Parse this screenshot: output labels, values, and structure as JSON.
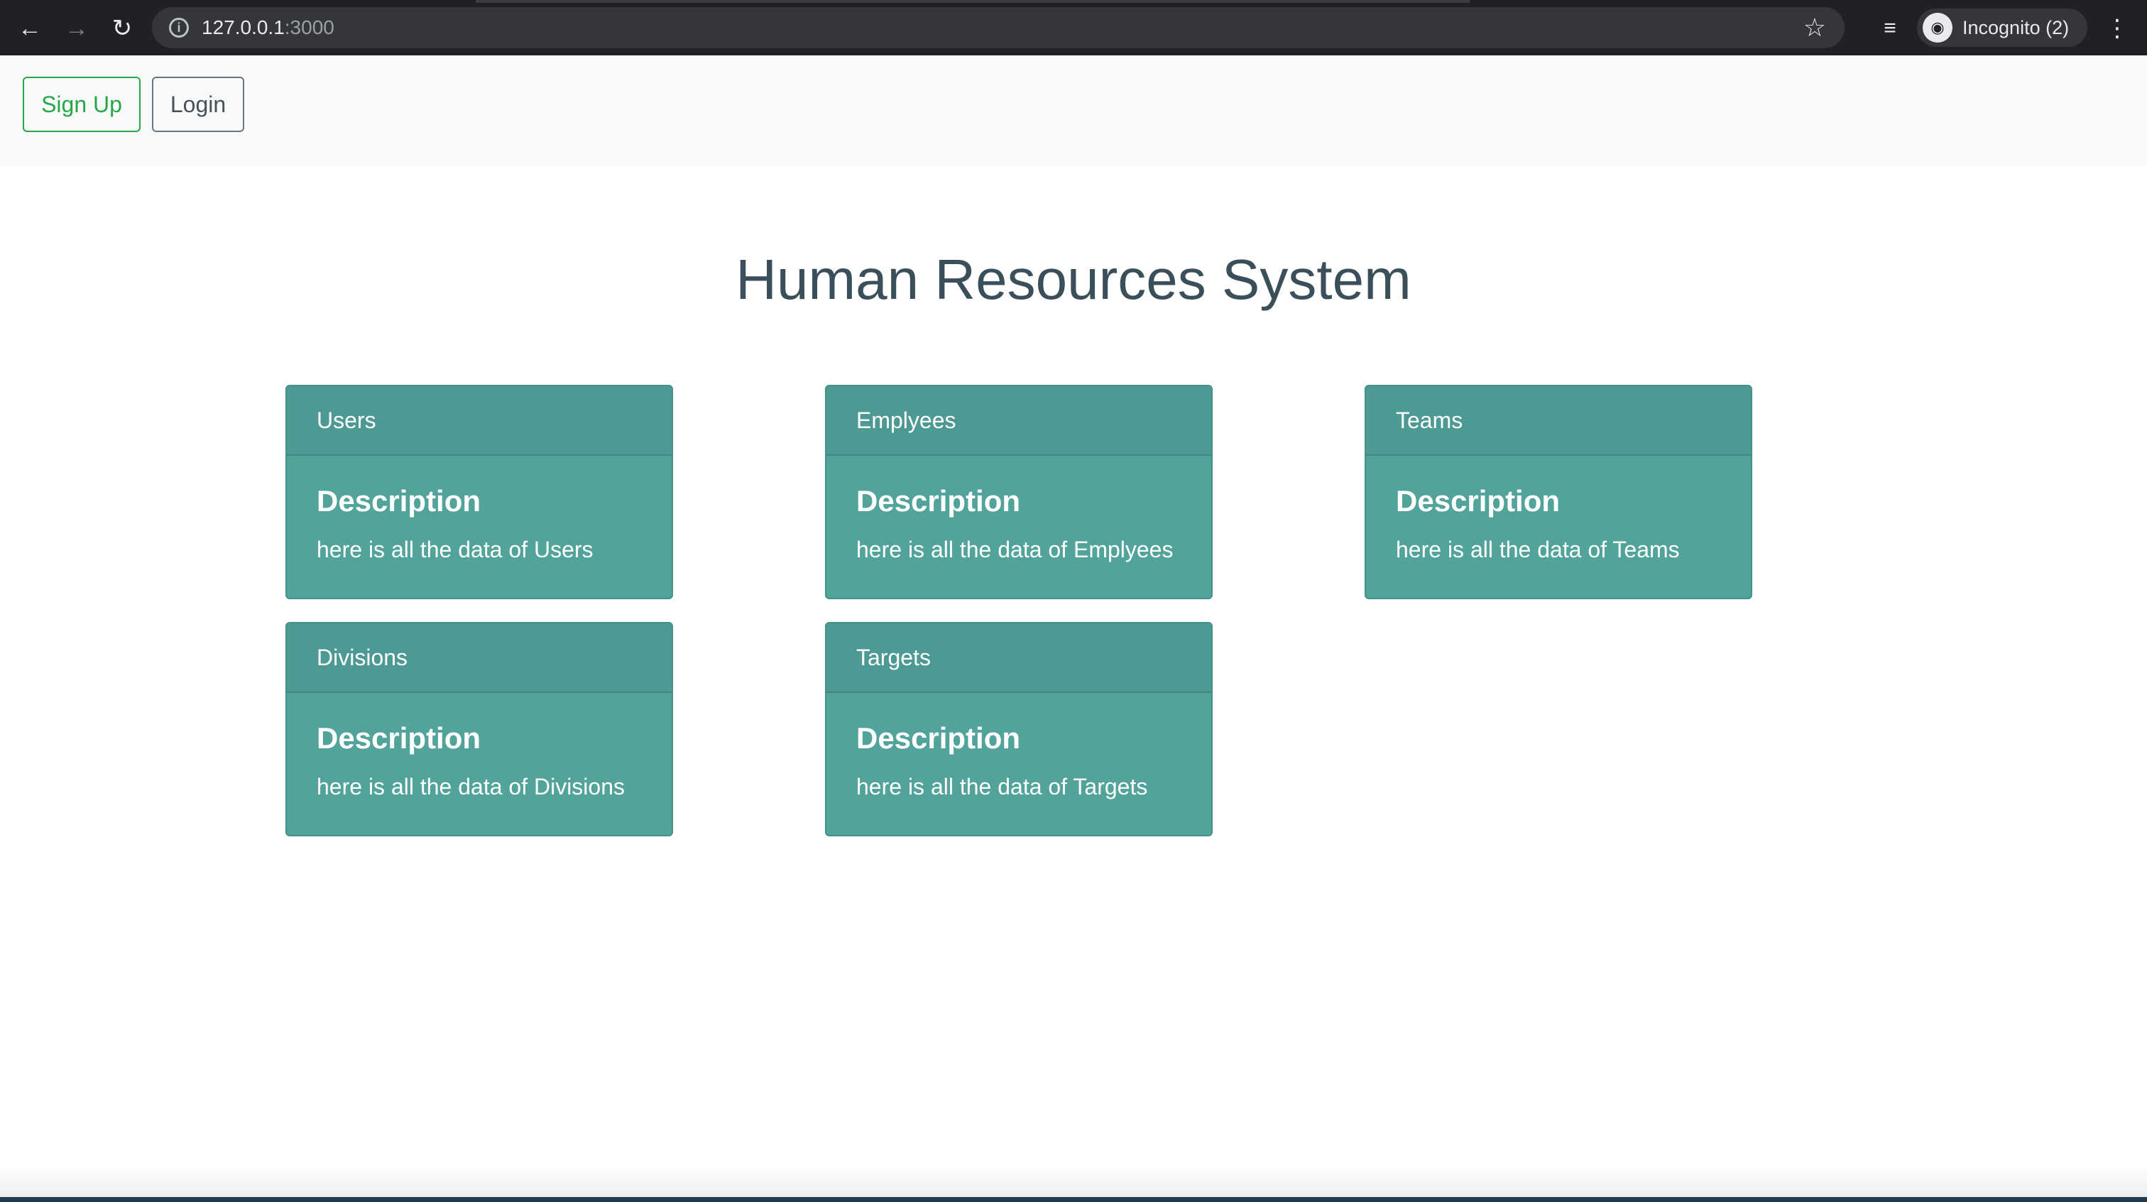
{
  "browser": {
    "url_host": "127.0.0.1",
    "url_port": ":3000",
    "profile_label": "Incognito (2)",
    "icons": {
      "back": "back-arrow-icon",
      "forward": "forward-arrow-icon",
      "reload": "reload-icon",
      "info": "info-icon",
      "bookmark": "star-icon",
      "tab_search": "tab-search-icon",
      "incognito": "incognito-icon",
      "menu": "kebab-menu-icon"
    }
  },
  "navbar": {
    "signup_label": "Sign Up",
    "login_label": "Login"
  },
  "main": {
    "title": "Human Resources System",
    "cards": [
      {
        "header": "Users",
        "title": "Description",
        "text": "here is all the data of Users"
      },
      {
        "header": "Emplyees",
        "title": "Description",
        "text": "here is all the data of Emplyees"
      },
      {
        "header": "Teams",
        "title": "Description",
        "text": "here is all the data of Teams"
      },
      {
        "header": "Divisions",
        "title": "Description",
        "text": "here is all the data of Divisions"
      },
      {
        "header": "Targets",
        "title": "Description",
        "text": "here is all the data of Targets"
      }
    ]
  },
  "colors": {
    "card_bg": "#52a39a",
    "signup_accent": "#28a745",
    "title_color": "#3a4f5a"
  }
}
